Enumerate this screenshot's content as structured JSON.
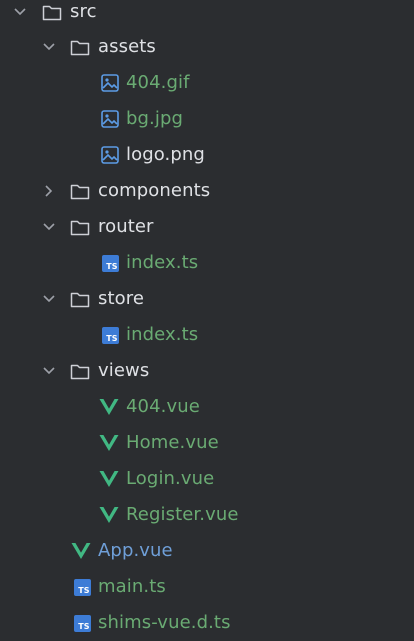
{
  "tree": {
    "src": {
      "label": "src",
      "expanded": true
    },
    "assets": {
      "label": "assets",
      "expanded": true
    },
    "assets_files": [
      {
        "label": "404.gif",
        "icon": "image-icon"
      },
      {
        "label": "bg.jpg",
        "icon": "image-icon"
      },
      {
        "label": "logo.png",
        "icon": "image-icon"
      }
    ],
    "components": {
      "label": "components",
      "expanded": false
    },
    "router": {
      "label": "router",
      "expanded": true
    },
    "router_files": [
      {
        "label": "index.ts",
        "icon": "typescript-file-icon",
        "badge": "TS"
      }
    ],
    "store": {
      "label": "store",
      "expanded": true
    },
    "store_files": [
      {
        "label": "index.ts",
        "icon": "typescript-file-icon",
        "badge": "TS"
      }
    ],
    "views": {
      "label": "views",
      "expanded": true
    },
    "views_files": [
      {
        "label": "404.vue",
        "icon": "vue-file-icon"
      },
      {
        "label": "Home.vue",
        "icon": "vue-file-icon"
      },
      {
        "label": "Login.vue",
        "icon": "vue-file-icon"
      },
      {
        "label": "Register.vue",
        "icon": "vue-file-icon"
      }
    ],
    "src_files": [
      {
        "label": "App.vue",
        "icon": "vue-file-icon"
      },
      {
        "label": "main.ts",
        "icon": "typescript-file-icon",
        "badge": "TS"
      },
      {
        "label": "shims-vue.d.ts",
        "icon": "typescript-file-icon",
        "badge": "TS"
      }
    ]
  },
  "colors": {
    "background": "#2b2d30",
    "folder_text": "#dfe1e5",
    "vcs_added_green": "#6aab73",
    "vcs_modified_blue": "#6f9fd8",
    "ts_badge": "#3d7cd6",
    "vue_green": "#41b883"
  }
}
